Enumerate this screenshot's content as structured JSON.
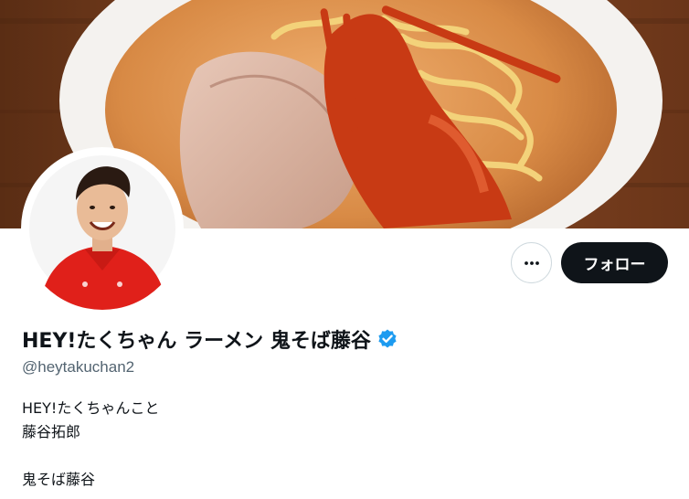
{
  "profile": {
    "display_name": "HEY!たくちゃん ラーメン 鬼そば藤谷",
    "handle": "@heytakuchan2",
    "bio": {
      "line1": "HEY!たくちゃんこと",
      "line2": "藤谷拓郎",
      "line3": "鬼そば藤谷"
    }
  },
  "actions": {
    "follow_label": "フォロー",
    "more_icon": "more-horizontal-icon"
  },
  "icons": {
    "verified": "verified-badge-icon"
  },
  "colors": {
    "follow_bg": "#0f1419",
    "verified_blue": "#1d9bf0",
    "handle_gray": "#536471"
  }
}
